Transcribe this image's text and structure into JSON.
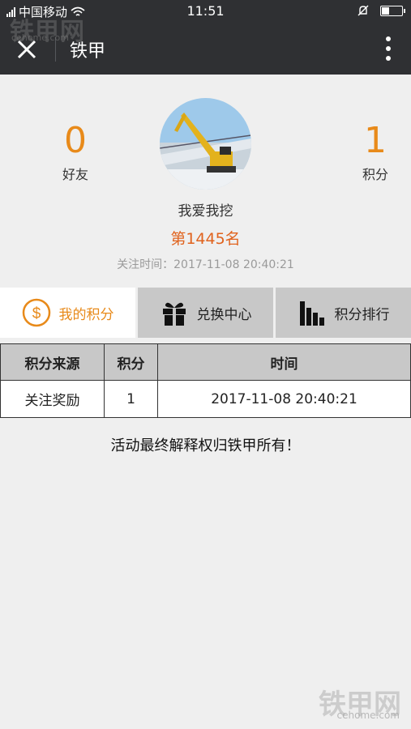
{
  "status_bar": {
    "carrier": "中国移动",
    "time": "11:51",
    "battery_level": 0.35
  },
  "nav": {
    "title": "铁甲",
    "close_icon": "close-icon",
    "more_icon": "more-vertical-icon"
  },
  "profile": {
    "friends_count": "0",
    "friends_label": "好友",
    "points_count": "1",
    "points_label": "积分",
    "nickname": "我爱我挖",
    "rank": "第1445名",
    "follow_time": "关注时间：2017-11-08 20:40:21"
  },
  "tabs": [
    {
      "label": "我的积分",
      "icon": "coin-icon",
      "active": true
    },
    {
      "label": "兑换中心",
      "icon": "gift-icon",
      "active": false
    },
    {
      "label": "积分排行",
      "icon": "bar-chart-icon",
      "active": false
    }
  ],
  "table": {
    "headers": [
      "积分来源",
      "积分",
      "时间"
    ],
    "rows": [
      [
        "关注奖励",
        "1",
        "2017-11-08 20:40:21"
      ]
    ]
  },
  "footer_note": "活动最终解释权归铁甲所有！",
  "watermark": {
    "brand": "铁甲网",
    "site": "cehome.com"
  },
  "colors": {
    "accent": "#e88a1a",
    "rank": "#e0631e",
    "navbar": "#2f3033",
    "tab_inactive": "#c8c8c8"
  }
}
